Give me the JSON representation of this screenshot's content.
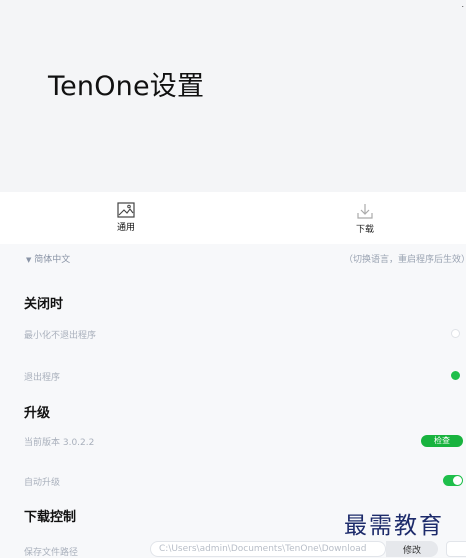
{
  "header": {
    "title": "TenOne设置",
    "corner_mark": "."
  },
  "tabs": [
    {
      "label": "通用",
      "icon": "image-icon"
    },
    {
      "label": "下载",
      "icon": "download-icon"
    }
  ],
  "language": {
    "selected": "简体中文",
    "note": "（切换语言，重启程序后生效）"
  },
  "on_close": {
    "title": "关闭时",
    "options": [
      {
        "label": "最小化不退出程序",
        "selected": false
      },
      {
        "label": "退出程序",
        "selected": true
      }
    ]
  },
  "upgrade": {
    "title": "升级",
    "current_version": "当前版本 3.0.2.2",
    "check_label": "检查",
    "auto_upgrade_label": "自动升级",
    "auto_upgrade_on": true
  },
  "download_control": {
    "title": "下载控制",
    "path_label": "保存文件路径",
    "path_value": "C:\\Users\\admin\\Documents\\TenOne\\Download",
    "change_label": "修改"
  },
  "watermark": "最需教育",
  "colors": {
    "accent": "#1fbf4b",
    "header_bg": "#f4f5f7",
    "page_bg": "#f7f8fa"
  }
}
